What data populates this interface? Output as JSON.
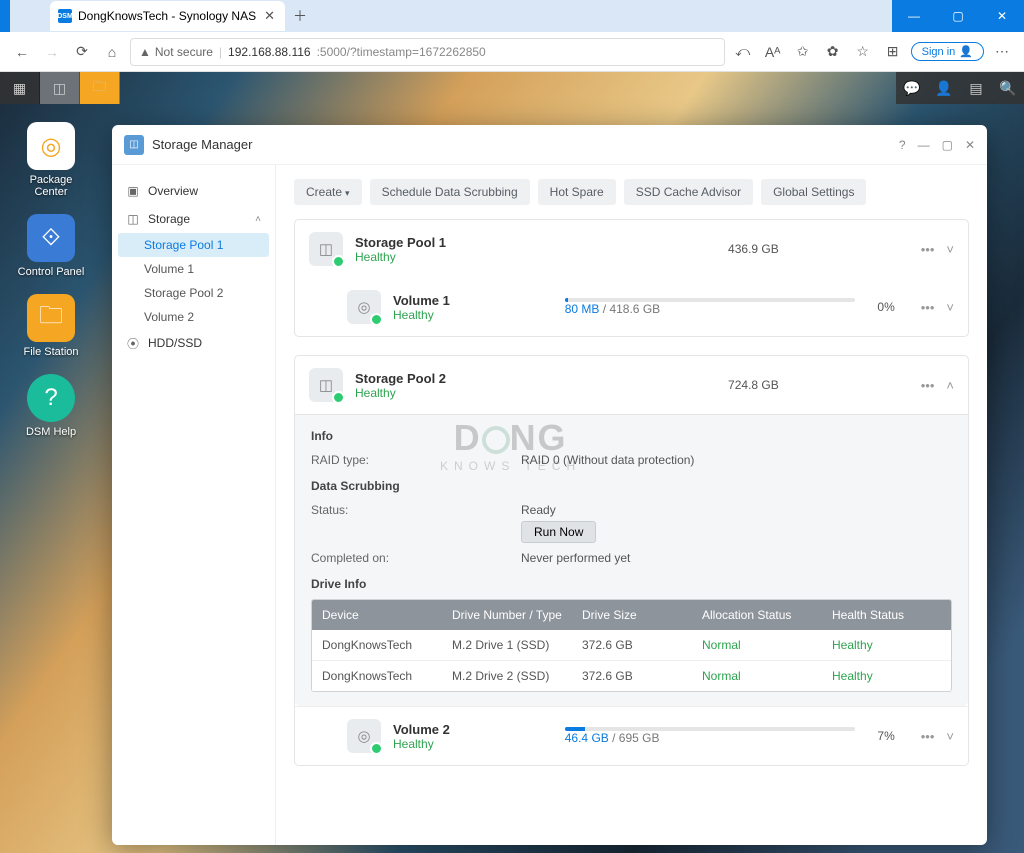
{
  "browser": {
    "tab_title": "DongKnowsTech - Synology NAS",
    "tab_favicon": "DSM",
    "not_secure": "Not secure",
    "url_host": "192.168.88.116",
    "url_rest": ":5000/?timestamp=1672262850",
    "sign_in": "Sign in"
  },
  "desktop_icons": [
    {
      "id": "package-center",
      "label": "Package\nCenter",
      "style": "pkg",
      "glyph": "◎"
    },
    {
      "id": "control-panel",
      "label": "Control Panel",
      "style": "cp",
      "glyph": "⟐"
    },
    {
      "id": "file-station",
      "label": "File Station",
      "style": "fs",
      "glyph": "🗀"
    },
    {
      "id": "dsm-help",
      "label": "DSM Help",
      "style": "help",
      "glyph": "?"
    }
  ],
  "window": {
    "title": "Storage Manager"
  },
  "sidebar": {
    "overview": "Overview",
    "storage": "Storage",
    "items": [
      "Storage Pool 1",
      "Volume 1",
      "Storage Pool 2",
      "Volume 2"
    ],
    "active_idx": 0,
    "hdd": "HDD/SSD"
  },
  "tabs": [
    "Create",
    "Schedule Data Scrubbing",
    "Hot Spare",
    "SSD Cache Advisor",
    "Global Settings"
  ],
  "pool1": {
    "title": "Storage Pool 1",
    "status": "Healthy",
    "size": "436.9 GB",
    "vol": {
      "title": "Volume 1",
      "status": "Healthy",
      "used": "80 MB",
      "total": "418.6 GB",
      "pct": "0%",
      "fill_pct": 1
    }
  },
  "pool2": {
    "title": "Storage Pool 2",
    "status": "Healthy",
    "size": "724.8 GB",
    "info": {
      "heading": "Info",
      "raid_label": "RAID type:",
      "raid_value": "RAID 0 (Without data protection)",
      "scrub_heading": "Data Scrubbing",
      "status_label": "Status:",
      "status_value": "Ready",
      "run_now": "Run Now",
      "completed_label": "Completed on:",
      "completed_value": "Never performed yet"
    },
    "drive_info_heading": "Drive Info",
    "drive_headers": [
      "Device",
      "Drive Number / Type",
      "Drive Size",
      "Allocation Status",
      "Health Status"
    ],
    "drives": [
      {
        "device": "DongKnowsTech",
        "slot": "M.2 Drive 1 (SSD)",
        "size": "372.6 GB",
        "alloc": "Normal",
        "health": "Healthy"
      },
      {
        "device": "DongKnowsTech",
        "slot": "M.2 Drive 2 (SSD)",
        "size": "372.6 GB",
        "alloc": "Normal",
        "health": "Healthy"
      }
    ],
    "vol": {
      "title": "Volume 2",
      "status": "Healthy",
      "used": "46.4 GB",
      "total": "695 GB",
      "pct": "7%",
      "fill_pct": 7
    }
  },
  "watermark": {
    "line1": "DONG",
    "line2": "KNOWS TECH"
  }
}
